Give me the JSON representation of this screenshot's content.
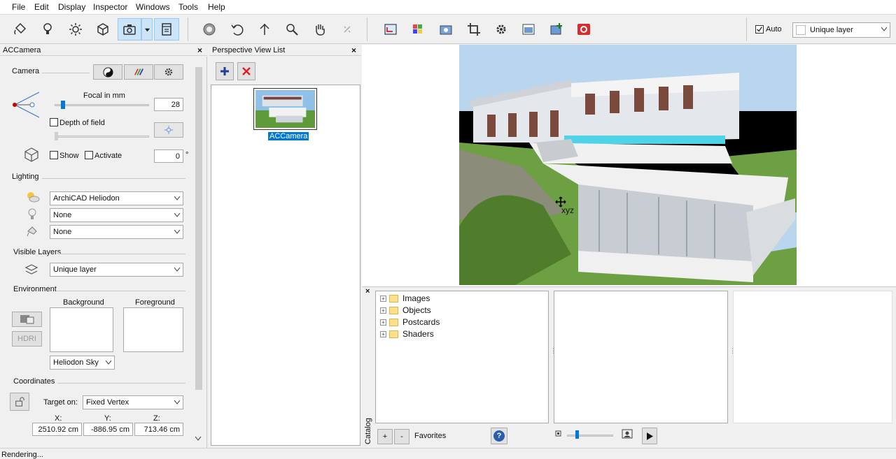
{
  "menu": [
    "File",
    "Edit",
    "Display",
    "Inspector",
    "Windows",
    "Tools",
    "Help"
  ],
  "toolbar": {
    "auto_label": "Auto",
    "auto_checked": true,
    "layer_select": "Unique layer"
  },
  "left_panel": {
    "title": "ACCamera",
    "camera_label": "Camera",
    "focal_label": "Focal in mm",
    "focal_value": "28",
    "focal_fraction": 0.07,
    "depth_of_field_label": "Depth of field",
    "show_label": "Show",
    "activate_label": "Activate",
    "angle_value": "0",
    "degree_symbol": "°",
    "lighting_label": "Lighting",
    "sun_select": "ArchiCAD Heliodon",
    "light_select": "None",
    "light2_select": "None",
    "visible_layers_label": "Visible Layers",
    "layer_select": "Unique layer",
    "environment_label": "Environment",
    "background_label": "Background",
    "foreground_label": "Foreground",
    "hdri_label": "HDRI",
    "sky_select": "Heliodon Sky",
    "coordinates_label": "Coordinates",
    "target_on_label": "Target on:",
    "target_select": "Fixed Vertex",
    "x_label": "X:",
    "y_label": "Y:",
    "z_label": "Z:",
    "x_value": "2510.92 cm",
    "y_value": "-886.95 cm",
    "z_value": "713.46 cm"
  },
  "view_list": {
    "title": "Perspective View List",
    "item_label": "ACCamera"
  },
  "viewport": {
    "cursor_label": "xyz"
  },
  "catalog": {
    "side_label": "Catalog",
    "tree": [
      "Images",
      "Objects",
      "Postcards",
      "Shaders"
    ],
    "add_label": "+",
    "remove_label": "-",
    "favorites_label": "Favorites",
    "help_label": "?"
  },
  "status": {
    "text": "Rendering..."
  }
}
